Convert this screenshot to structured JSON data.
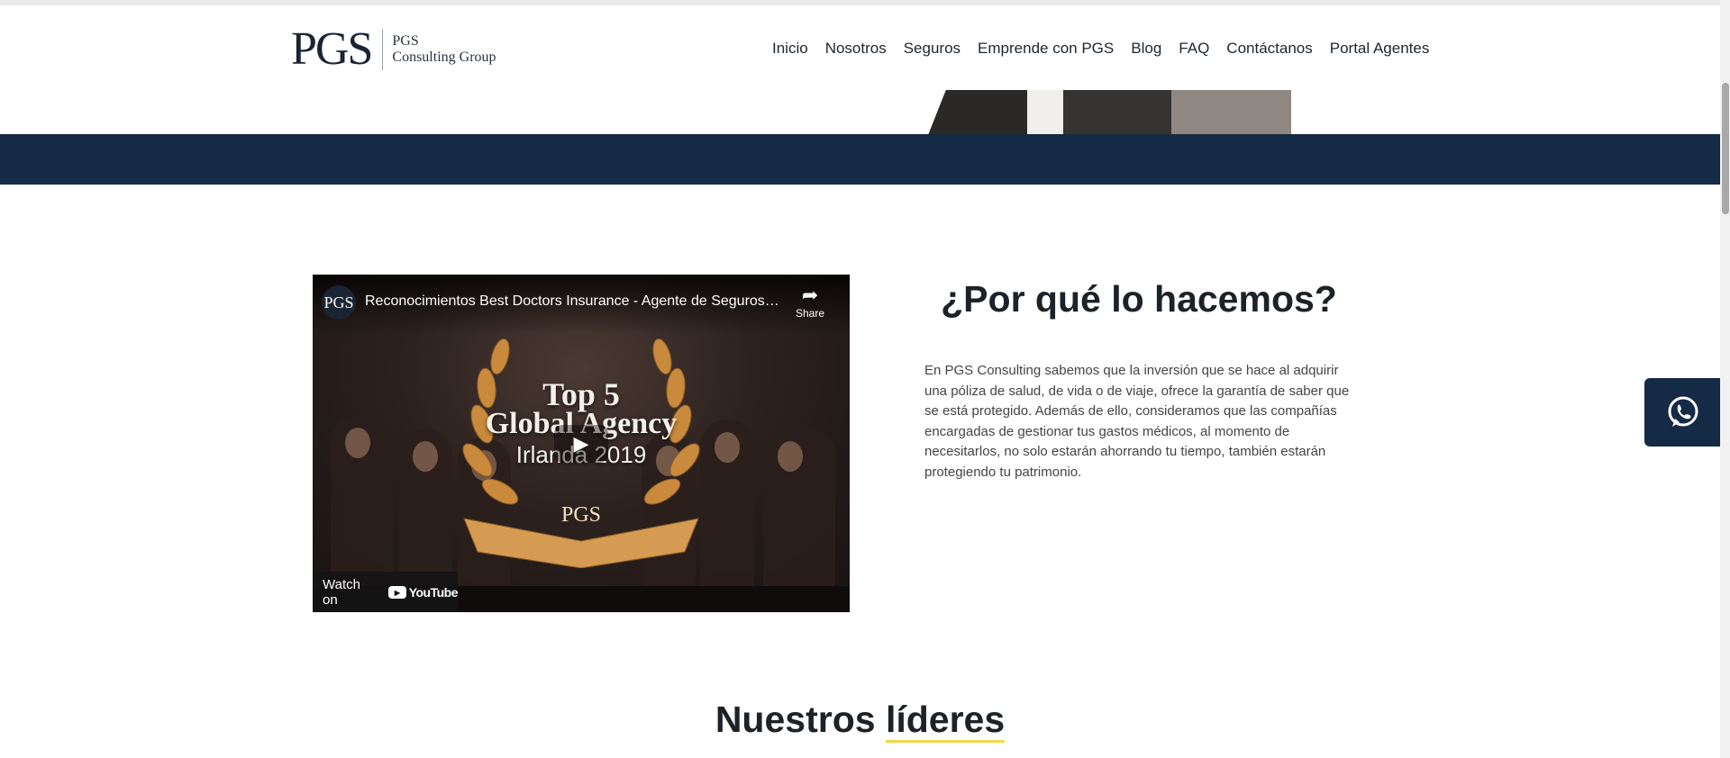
{
  "header": {
    "logo_mark": "PGS",
    "logo_line1": "PGS",
    "logo_line2": "Consulting Group",
    "nav": [
      {
        "label": "Inicio"
      },
      {
        "label": "Nosotros"
      },
      {
        "label": "Seguros"
      },
      {
        "label": "Emprende con PGS"
      },
      {
        "label": "Blog"
      },
      {
        "label": "FAQ"
      },
      {
        "label": "Contáctanos"
      },
      {
        "label": "Portal Agentes"
      }
    ]
  },
  "colors": {
    "brand_navy": "#152a44",
    "accent_yellow": "#f0d84a"
  },
  "video": {
    "channel_avatar": "PGS",
    "title": "Reconocimientos Best Doctors Insurance - Agente de Seguros…",
    "share_label": "Share",
    "award_line1": "Top 5",
    "award_line2": "Global Agency",
    "award_line3": "Irlanda 2019",
    "ribbon_text": "PGS",
    "watch_label": "Watch on",
    "youtube_label": "YouTube",
    "icons": [
      "share-icon",
      "play-icon",
      "youtube-icon"
    ]
  },
  "why": {
    "title": "¿Por qué lo hacemos?",
    "body": "En PGS Consulting sabemos que la inversión que se hace al adquirir una póliza de salud, de vida o de viaje, ofrece la garantía de saber que se está protegido. Además de ello, consideramos que las compañías encargadas de gestionar tus gastos médicos, al momento de necesitarlos, no solo estarán ahorrando tu tiempo, también estarán protegiendo tu patrimonio."
  },
  "floating": {
    "whatsapp_icon": "whatsapp-icon"
  },
  "leaders": {
    "title_regular": "Nuestros",
    "title_bold": "líderes"
  }
}
